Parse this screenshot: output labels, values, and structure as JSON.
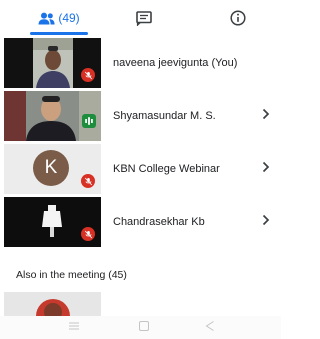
{
  "tabs": {
    "people_label": "(49)",
    "people_icon": "people-icon",
    "chat_icon": "chat-icon",
    "info_icon": "info-icon",
    "accent": "#1a73e8"
  },
  "participants": [
    {
      "name": "naveena jeevigunta (You)",
      "muted": true,
      "has_chevron": false
    },
    {
      "name": "Shyamasundar M. S.",
      "muted": false,
      "speaking": true,
      "has_chevron": true
    },
    {
      "name": "KBN College Webinar",
      "avatar_letter": "K",
      "muted": true,
      "has_chevron": true
    },
    {
      "name": "Chandrasekhar Kb",
      "muted": true,
      "has_chevron": true
    }
  ],
  "also_in_meeting_label": "Also in the meeting (45)",
  "nav": {
    "icons": [
      "menu-icon",
      "home-square-icon",
      "back-triangle-icon"
    ]
  },
  "colors": {
    "muted_red": "#d93025",
    "speaking_green": "#1e8e3e",
    "avatar_brown": "#7a5c48"
  }
}
